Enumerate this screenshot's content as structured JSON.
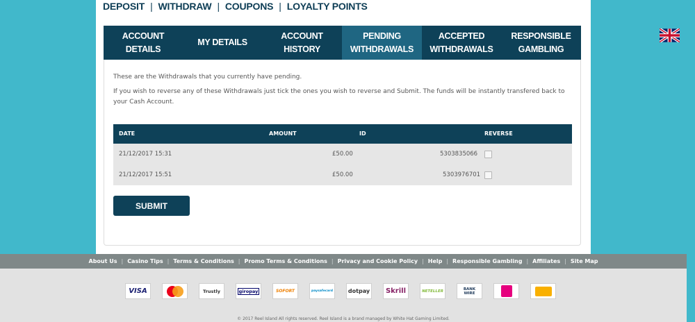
{
  "top_nav": [
    {
      "label": "Deposit"
    },
    {
      "label": "Withdraw"
    },
    {
      "label": "Coupons"
    },
    {
      "label": "Loyalty Points"
    }
  ],
  "tabs": [
    {
      "label": "Account Details"
    },
    {
      "label": "My Details"
    },
    {
      "label": "Account History"
    },
    {
      "label": "Pending Withdrawals"
    },
    {
      "label": "Accepted Withdrawals"
    },
    {
      "label": "Responsible Gambling"
    }
  ],
  "active_tab": "Pending Withdrawals",
  "intro": {
    "line1": "These are the Withdrawals that you currently have pending.",
    "line2": "If you wish to reverse any of these Withdrawals just tick the ones you wish to reverse and Submit. The funds will be instantly transfered back to your Cash Account."
  },
  "table": {
    "headers": {
      "date": "DATE",
      "amount": "AMOUNT",
      "id": "ID",
      "reverse": "REVERSE"
    },
    "rows": [
      {
        "date": "21/12/2017 15:31",
        "amount": "£50.00",
        "id": "5303835066",
        "reverse": false
      },
      {
        "date": "21/12/2017 15:51",
        "amount": "£50.00",
        "id": "5303976701",
        "reverse": false
      }
    ]
  },
  "submit_label": "SUBMIT",
  "footer_links": [
    {
      "label": "About Us"
    },
    {
      "label": "Casino Tips"
    },
    {
      "label": "Terms & Conditions"
    },
    {
      "label": "Promo Terms & Conditions"
    },
    {
      "label": "Privacy and Cookie Policy"
    },
    {
      "label": "Help"
    },
    {
      "label": "Responsible Gambling"
    },
    {
      "label": "Affiliates"
    },
    {
      "label": "Site Map"
    }
  ],
  "payment_methods": [
    {
      "label": "VISA",
      "color": "#1a1f71",
      "icon": "visa-icon"
    },
    {
      "label": "MasterCard",
      "color": "#eb001b",
      "icon": "mastercard-icon"
    },
    {
      "label": "Trustly",
      "color": "#0ee06e",
      "icon": "trustly-icon"
    },
    {
      "label": "giropay",
      "color": "#000268",
      "icon": "giropay-icon"
    },
    {
      "label": "SOFORT",
      "color": "#ee7f00",
      "icon": "sofort-icon"
    },
    {
      "label": "paysafecard",
      "color": "#0089c7",
      "icon": "paysafecard-icon"
    },
    {
      "label": "dotpay",
      "color": "#d40000",
      "icon": "dotpay-icon"
    },
    {
      "label": "Skrill",
      "color": "#862165",
      "icon": "skrill-icon"
    },
    {
      "label": "NETELLER",
      "color": "#83ba3b",
      "icon": "neteller-icon"
    },
    {
      "label": "BANK WIRE",
      "color": "#1f3a5a",
      "icon": "bank-wire-icon"
    },
    {
      "label": "",
      "color": "#e6007e",
      "icon": "shopping-bag-icon"
    },
    {
      "label": "",
      "color": "#f9b000",
      "icon": "prepaid-card-icon"
    }
  ],
  "copyright": "© 2017 Reel Island All rights reserved. Reel Island is a brand managed by White Hat Gaming Limited.",
  "colors": {
    "background": "#41b8cb",
    "navy": "#0e4158",
    "active_tab": "#1f6682",
    "footer_links_bg": "#7f8888",
    "footer_bg": "#e2e2e2"
  }
}
